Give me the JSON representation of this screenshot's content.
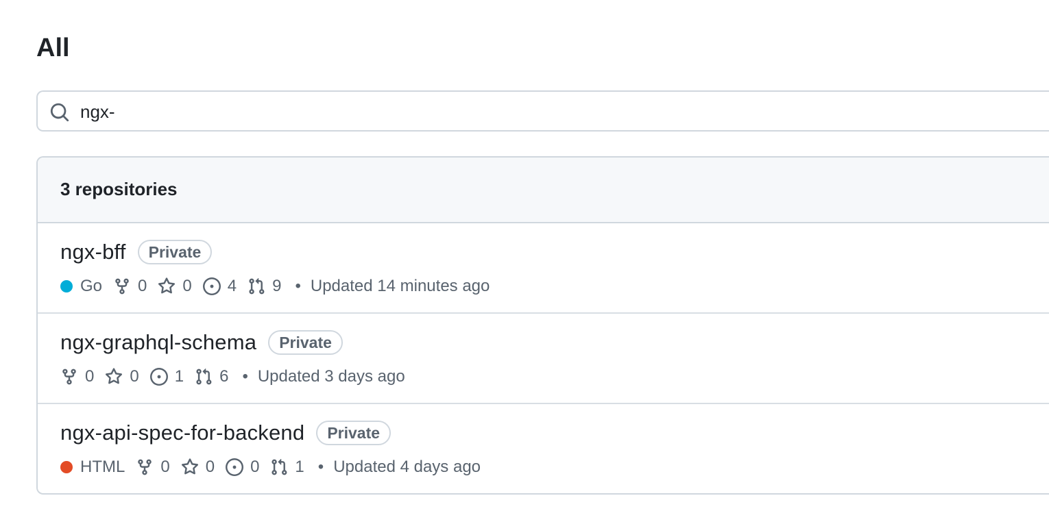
{
  "page": {
    "title": "All"
  },
  "search": {
    "value": "ngx-",
    "icon": "search-icon"
  },
  "repositories_panel": {
    "count_label": "3 repositories",
    "items": [
      {
        "name": "ngx-bff",
        "visibility": "Private",
        "language": "Go",
        "language_color": "#00ADD8",
        "forks": "0",
        "stars": "0",
        "issues": "4",
        "pull_requests": "9",
        "separator": "•",
        "updated": "Updated 14 minutes ago"
      },
      {
        "name": "ngx-graphql-schema",
        "visibility": "Private",
        "language": "",
        "language_color": "",
        "forks": "0",
        "stars": "0",
        "issues": "1",
        "pull_requests": "6",
        "separator": "•",
        "updated": "Updated 3 days ago"
      },
      {
        "name": "ngx-api-spec-for-backend",
        "visibility": "Private",
        "language": "HTML",
        "language_color": "#e34c26",
        "forks": "0",
        "stars": "0",
        "issues": "0",
        "pull_requests": "1",
        "separator": "•",
        "updated": "Updated 4 days ago"
      }
    ]
  },
  "icons": {
    "fork": "repo-forked-icon",
    "star": "star-icon",
    "issue": "issue-opened-icon",
    "pull_request": "git-pull-request-icon"
  },
  "colors": {
    "text_primary": "#1f2328",
    "text_muted": "#59636e",
    "border": "#d0d7de",
    "header_bg": "#f6f8fa"
  }
}
